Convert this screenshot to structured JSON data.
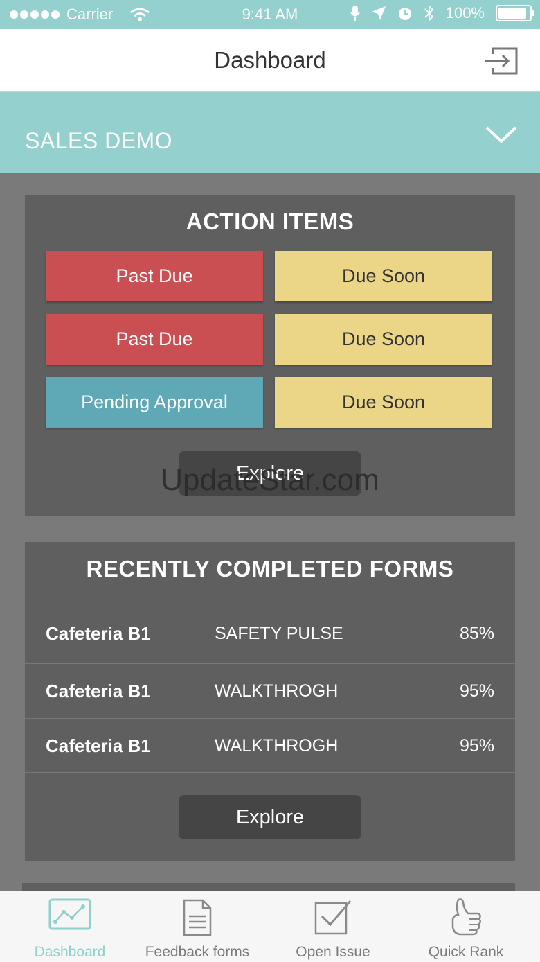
{
  "status_bar": {
    "carrier": "Carrier",
    "time": "9:41 AM",
    "battery": "100%",
    "battery_level": 1.0
  },
  "nav": {
    "title": "Dashboard",
    "logout_icon": "logout-icon"
  },
  "org_selector": {
    "name": "SALES DEMO",
    "icon": "chevron-down-icon"
  },
  "action_items": {
    "title": "ACTION ITEMS",
    "tiles": [
      {
        "label": "Past Due",
        "color": "#c94f52"
      },
      {
        "label": "Due Soon",
        "color": "#ebd688"
      },
      {
        "label": "Past Due",
        "color": "#c94f52"
      },
      {
        "label": "Due Soon",
        "color": "#ebd688"
      },
      {
        "label": "Pending Approval",
        "color": "#5fa9b6"
      },
      {
        "label": "Due Soon",
        "color": "#ebd688"
      }
    ],
    "explore_label": "Explore"
  },
  "watermark": "UpdateStar.com",
  "recent_forms": {
    "title": "RECENTLY COMPLETED FORMS",
    "rows": [
      {
        "place": "Cafeteria B1",
        "form": "SAFETY PULSE",
        "score": "85%"
      },
      {
        "place": "Cafeteria B1",
        "form": "WALKTHROGH",
        "score": "95%"
      },
      {
        "place": "Cafeteria B1",
        "form": "WALKTHROGH",
        "score": "95%"
      }
    ],
    "explore_label": "Explore"
  },
  "tab_bar": {
    "tabs": [
      {
        "label": "Dashboard",
        "icon": "chart-icon",
        "active": true
      },
      {
        "label": "Feedback forms",
        "icon": "document-icon",
        "active": false
      },
      {
        "label": "Open Issue",
        "icon": "checkbox-icon",
        "active": false
      },
      {
        "label": "Quick Rank",
        "icon": "thumbs-up-icon",
        "active": false
      }
    ]
  },
  "colors": {
    "accent": "#94d0ce",
    "card": "#5f5f5f",
    "page_bg": "#7a7a7a"
  }
}
